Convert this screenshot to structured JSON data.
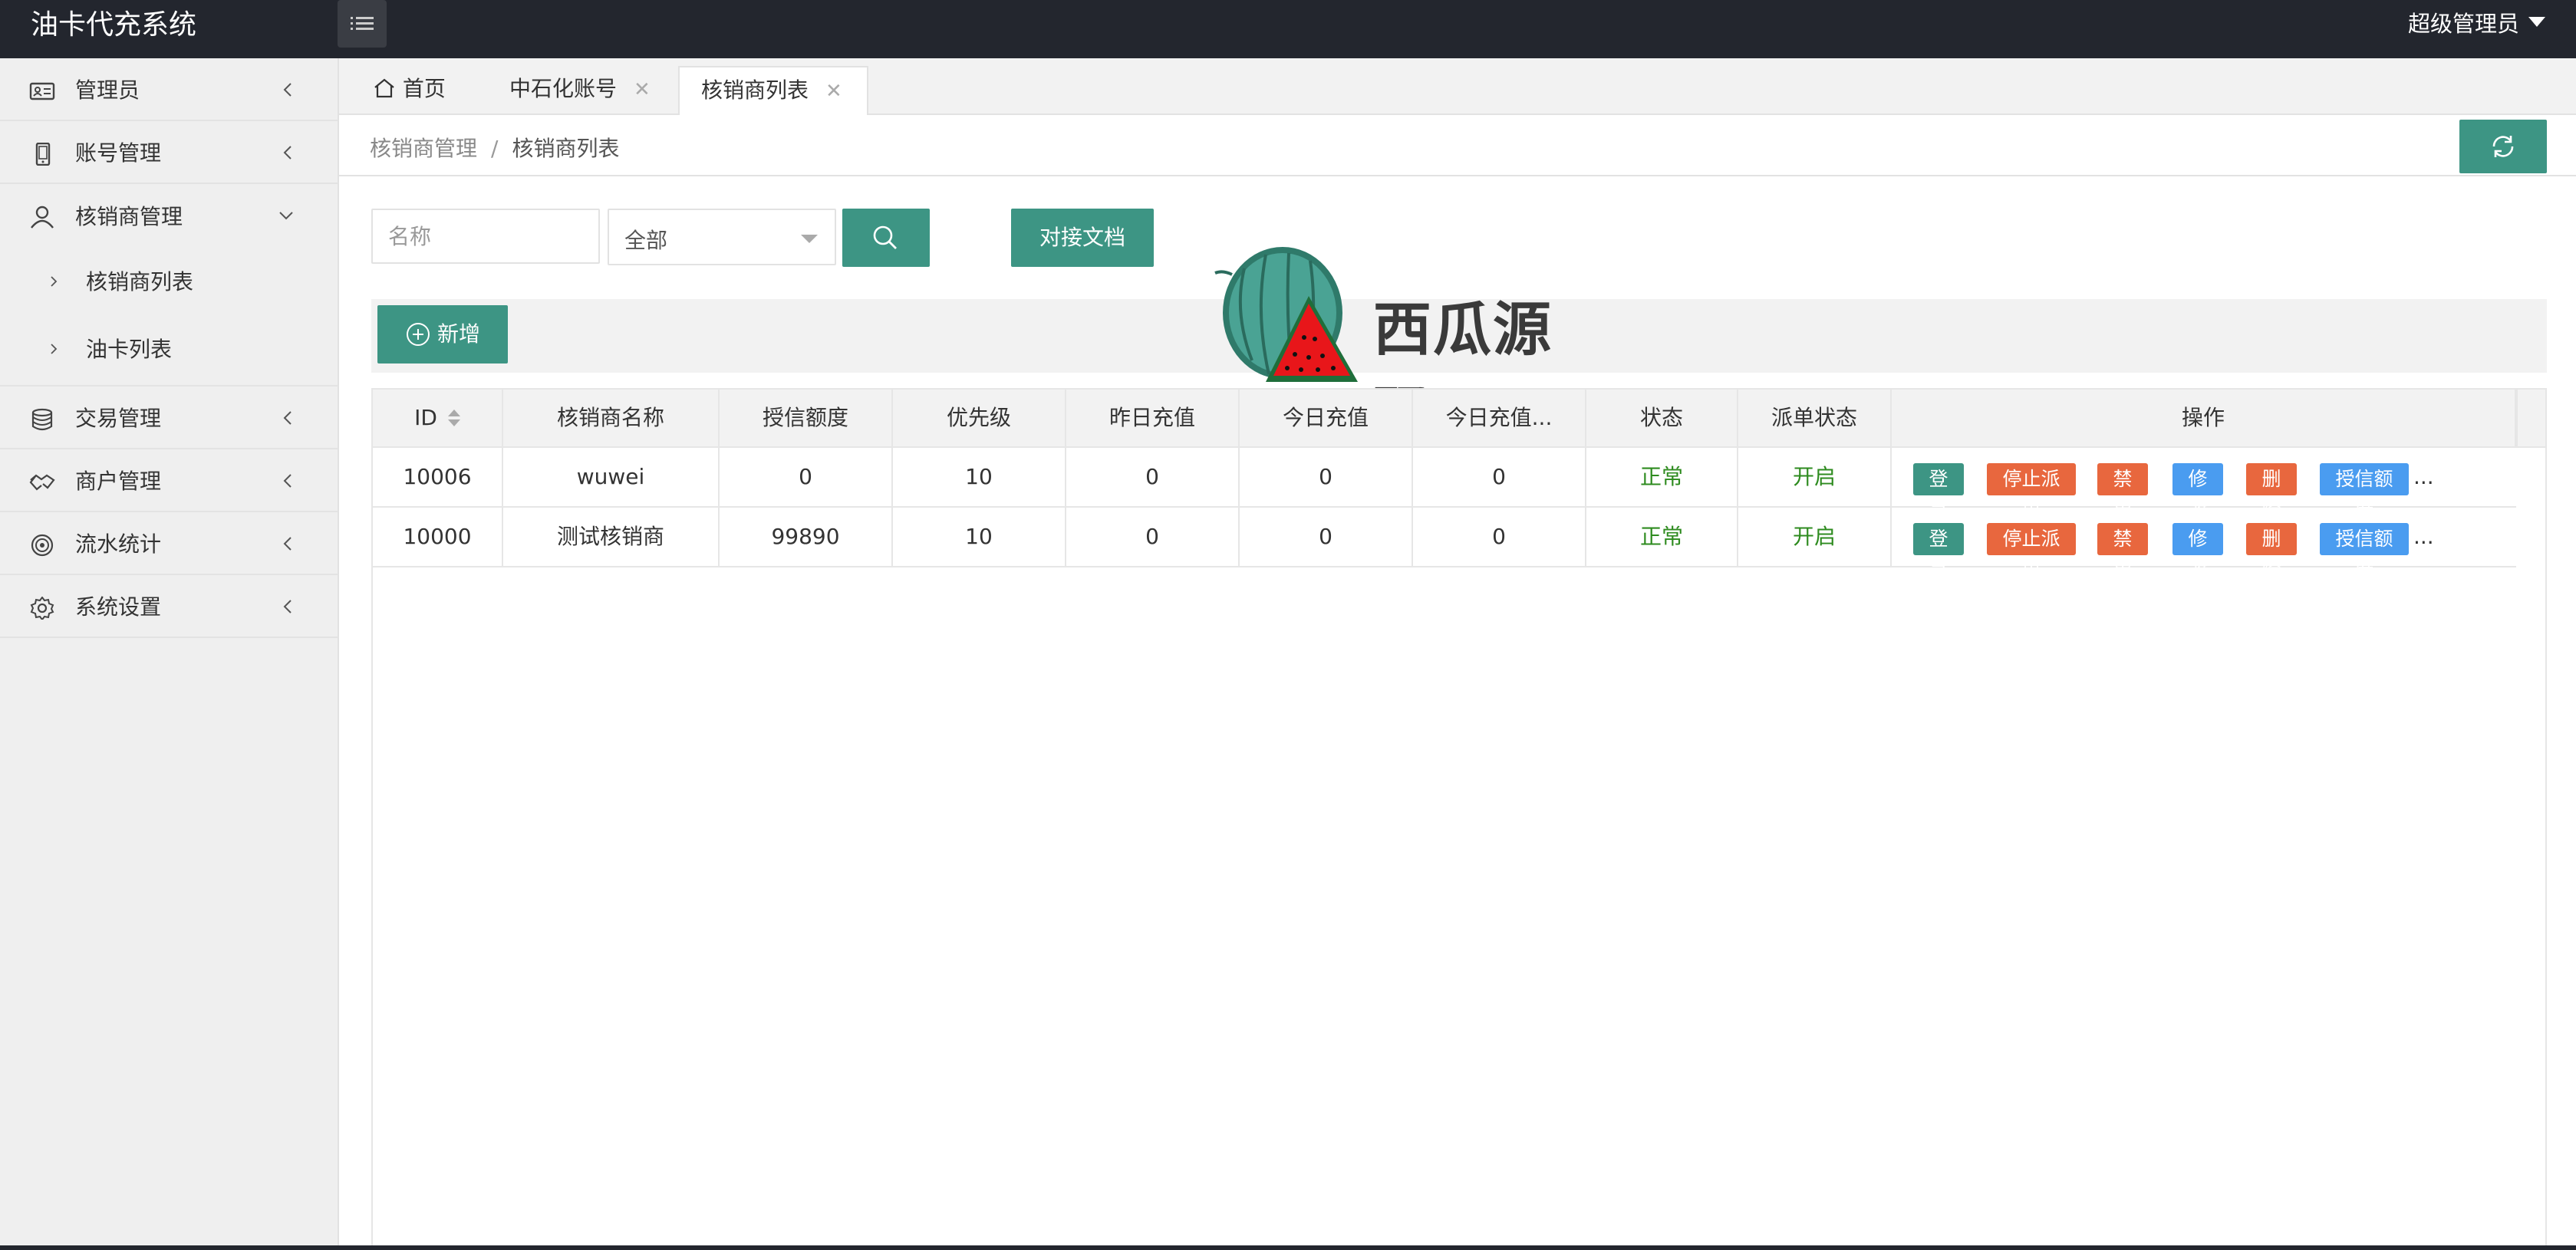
{
  "header": {
    "app_title": "油卡代充系统",
    "user_label": "超级管理员"
  },
  "sidebar": {
    "items": [
      {
        "label": "管理员",
        "icon": "id-card-icon"
      },
      {
        "label": "账号管理",
        "icon": "phone-icon"
      },
      {
        "label": "核销商管理",
        "icon": "user-icon"
      },
      {
        "label": "交易管理",
        "icon": "database-icon"
      },
      {
        "label": "商户管理",
        "icon": "handshake-icon"
      },
      {
        "label": "流水统计",
        "icon": "target-icon"
      },
      {
        "label": "系统设置",
        "icon": "gear-icon"
      }
    ],
    "sub_items": [
      {
        "label": "核销商列表"
      },
      {
        "label": "油卡列表"
      }
    ]
  },
  "tabs": [
    {
      "label": "首页"
    },
    {
      "label": "中石化账号"
    },
    {
      "label": "核销商列表"
    }
  ],
  "breadcrumb": {
    "parent": "核销商管理",
    "separator": "/",
    "current": "核销商列表"
  },
  "filter": {
    "name_placeholder": "名称",
    "select_value": "全部",
    "doc_button": "对接文档"
  },
  "toolbar": {
    "add_label": "新增"
  },
  "watermark": {
    "text": "西瓜源码"
  },
  "table": {
    "headers": [
      "ID",
      "核销商名称",
      "授信额度",
      "优先级",
      "昨日充值",
      "今日充值",
      "今日充值...",
      "状态",
      "派单状态",
      "操作"
    ],
    "rows": [
      {
        "id": "10006",
        "name": "wuwei",
        "credit": "0",
        "priority": "10",
        "yesterday": "0",
        "today": "0",
        "today2": "0",
        "status": "正常",
        "dispatch": "开启"
      },
      {
        "id": "10000",
        "name": "测试核销商",
        "credit": "99890",
        "priority": "10",
        "yesterday": "0",
        "today": "0",
        "today2": "0",
        "status": "正常",
        "dispatch": "开启"
      }
    ],
    "actions": {
      "login": "登录",
      "stop": "停止派单",
      "disable": "禁用",
      "edit": "修改",
      "delete": "删除",
      "credit": "授信额度",
      "more": "..."
    }
  },
  "colors": {
    "accent": "#3d9584",
    "header_bg": "#23262e",
    "orange": "#e8673e",
    "blue": "#4a9cf0",
    "green_text": "#2e8b1f"
  }
}
